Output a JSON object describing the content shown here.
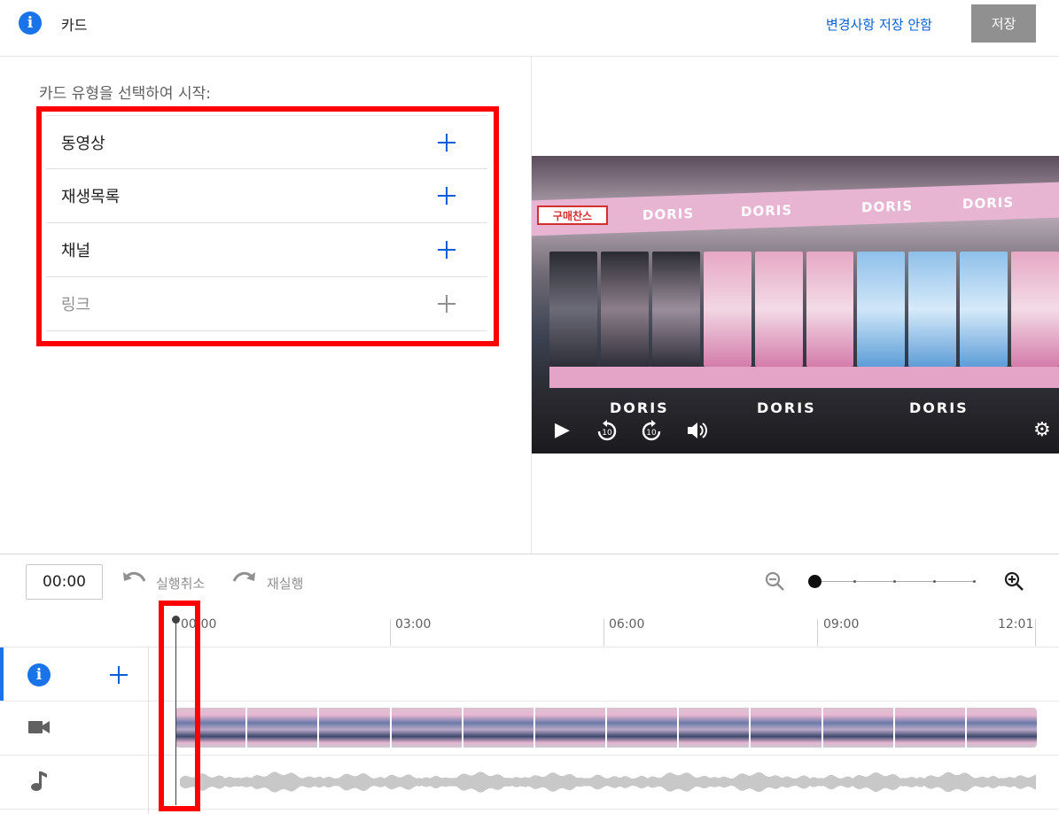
{
  "header": {
    "title": "카드",
    "discard_label": "변경사항 저장 안함",
    "save_label": "저장"
  },
  "left_panel": {
    "prompt": "카드 유형을 선택하여 시작:",
    "card_types": [
      {
        "label": "동영상",
        "enabled": true
      },
      {
        "label": "재생목록",
        "enabled": true
      },
      {
        "label": "채널",
        "enabled": true
      },
      {
        "label": "링크",
        "enabled": false
      }
    ]
  },
  "video_preview": {
    "brand_text": "DORIS",
    "sale_tag": "구매찬스",
    "controls": [
      "play-icon",
      "rewind-10-icon",
      "forward-10-icon",
      "volume-icon",
      "settings-icon"
    ]
  },
  "timeline": {
    "current_time": "00:00",
    "undo_label": "실행취소",
    "redo_label": "재실행",
    "ruler_ticks": [
      "00:00",
      "03:00",
      "06:00",
      "09:00",
      "12:01"
    ],
    "tracks": [
      "info-icon",
      "video-camera-icon",
      "music-note-icon"
    ]
  },
  "colors": {
    "accent_blue": "#065fd4",
    "info_blue": "#1a73e8",
    "highlight_red": "#ff0000",
    "save_button_grey": "#909090"
  }
}
